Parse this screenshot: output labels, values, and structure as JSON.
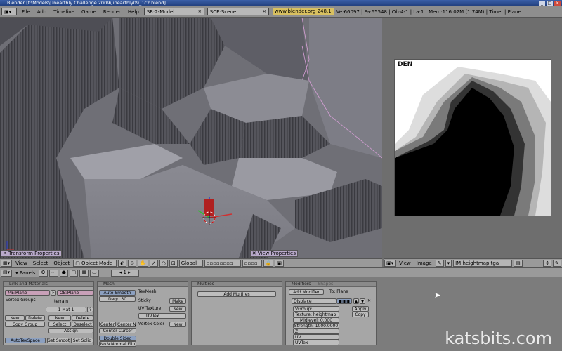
{
  "title": "Blender [f:\\Models\\Unearthly Challenge 2009\\unearthly09_1c2.blend]",
  "menu": [
    "File",
    "Add",
    "Timeline",
    "Game",
    "Render",
    "Help"
  ],
  "screen_field": "SR:2-Model",
  "scene_field": "SCE:Scene",
  "url": "www.blender.org 248.1",
  "stats": "Ve:66097 | Fa:65548 | Ob:4-1 | La:1 | Mem:116.02M (1.74M) | Time: | Plane",
  "image_label": "DEN",
  "viewport_header": {
    "panel_label": "Transform Properties",
    "menus": [
      "View",
      "Select",
      "Object"
    ],
    "mode": "Object Mode",
    "orientation": "Global"
  },
  "view_props_label": "View Properties",
  "image_header": {
    "menus": [
      "View",
      "Image"
    ],
    "image_name": "IM:heightmap.tga"
  },
  "buttons_header": {
    "panels_label": "Panels",
    "frame": "1"
  },
  "link_materials": {
    "title": "Link and Materials",
    "me": "ME:Plane",
    "f": "F",
    "ob": "OB:Plane",
    "vertex_groups": "Vertex Groups",
    "terrain": "terrain",
    "mat": "1 Mat 1",
    "q": "?",
    "new": "New",
    "delete": "Delete",
    "copy_group": "Copy Group",
    "select": "Select",
    "deselect": "Deselect",
    "assign": "Assign",
    "autotexspace": "AutoTexSpace",
    "set_smooth": "Set Smooth",
    "set_solid": "Set Solid"
  },
  "mesh": {
    "title": "Mesh",
    "auto_smooth": "Auto Smooth",
    "degr": "Degr: 30",
    "sticky": "Sticky",
    "make": "Make",
    "uv_texture": "UV Texture",
    "new": "New",
    "uvtex": "UVTex",
    "vertex_color": "Vertex Color",
    "center": "Center",
    "center_new": "Center New",
    "center_cursor": "Center Cursor",
    "double_sided": "Double Sided",
    "no_v_normal_flip": "No V.Normal Flip",
    "texmesh": "TexMesh:"
  },
  "multires": {
    "title": "Multires",
    "add": "Add Multires"
  },
  "modifiers": {
    "tab1": "Modifiers",
    "tab2": "Shapes",
    "add": "Add Modifier",
    "to": "To: Plane",
    "name": "Displace",
    "vgroup": "VGroup:",
    "texture": "Texture: heightmap",
    "midlevel": "Midlevel: 0.000",
    "strength": "Strength: 1000.0000",
    "axis_z": "Z",
    "uv": "UV",
    "uvtex": "UVTex",
    "apply": "Apply",
    "copy": "Copy"
  },
  "watermark": "katsbits.com"
}
